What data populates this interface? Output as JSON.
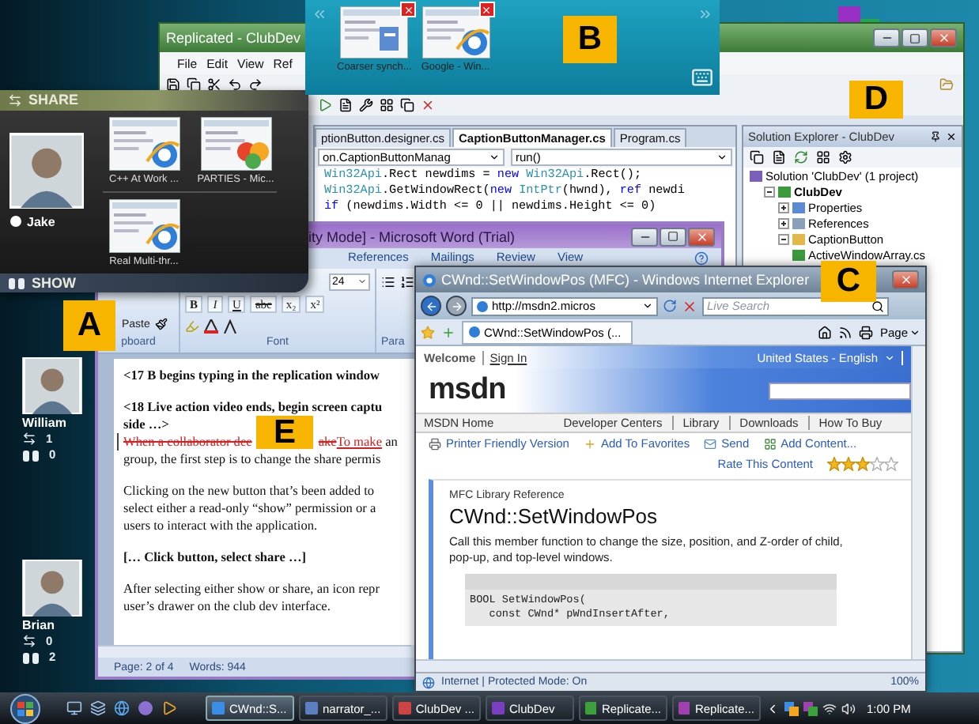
{
  "share_panel": {
    "header": "SHARE",
    "user": "Jake",
    "footer": "SHOW",
    "thumbnails": [
      {
        "caption": "C++ At Work ...",
        "kind": "browser"
      },
      {
        "caption": "PARTIES - Mic...",
        "kind": "messenger"
      },
      {
        "caption": "Real Multi-thr...",
        "kind": "browser"
      }
    ]
  },
  "switcher": {
    "thumbnails": [
      {
        "caption": "Coarser synch...",
        "kind": "document"
      },
      {
        "caption": "Google - Win...",
        "kind": "browser"
      }
    ]
  },
  "people": [
    {
      "name": "William",
      "share_count": "1",
      "show_count": "0"
    },
    {
      "name": "Brian",
      "share_count": "0",
      "show_count": "2"
    }
  ],
  "callouts": [
    "A",
    "B",
    "C",
    "D",
    "E"
  ],
  "visual_studio": {
    "title": "Replicated - ClubDev",
    "menu": [
      "File",
      "Edit",
      "View",
      "Ref"
    ],
    "tabs": [
      {
        "label": "ptionButton.designer.cs",
        "selected": false
      },
      {
        "label": "CaptionButtonManager.cs",
        "selected": true
      },
      {
        "label": "Program.cs",
        "selected": false
      }
    ],
    "type_combo": "on.CaptionButtonManag",
    "member_combo": "run()",
    "code_lines": [
      [
        {
          "kind": "type",
          "text": "Win32Api"
        },
        {
          "kind": "plain",
          "text": ".Rect newdims = "
        },
        {
          "kind": "keyword",
          "text": "new "
        },
        {
          "kind": "type",
          "text": "Win32Api"
        },
        {
          "kind": "plain",
          "text": ".Rect();"
        }
      ],
      [
        {
          "kind": "type",
          "text": "Win32Api"
        },
        {
          "kind": "plain",
          "text": ".GetWindowRect("
        },
        {
          "kind": "keyword",
          "text": "new "
        },
        {
          "kind": "type",
          "text": "IntPtr"
        },
        {
          "kind": "plain",
          "text": "(hwnd), "
        },
        {
          "kind": "keyword",
          "text": "ref"
        },
        {
          "kind": "plain",
          "text": " newdi"
        }
      ],
      [
        {
          "kind": "keyword",
          "text": "if"
        },
        {
          "kind": "plain",
          "text": " (newdims.Width <= 0 || newdims.Height <= 0)"
        }
      ]
    ],
    "solution_explorer": {
      "title": "Solution Explorer - ClubDev",
      "tree": [
        {
          "label": "Solution 'ClubDev' (1 project)",
          "kind": "solution",
          "children": [
            {
              "label": "ClubDev",
              "kind": "project",
              "expanded": true,
              "children": [
                {
                  "label": "Properties",
                  "kind": "properties",
                  "expanded": false
                },
                {
                  "label": "References",
                  "kind": "references",
                  "expanded": false
                },
                {
                  "label": "CaptionButton",
                  "kind": "folder",
                  "expanded": true,
                  "children": [
                    {
                      "label": "ActiveWindowArray.cs",
                      "kind": "file"
                    }
                  ]
                }
              ]
            }
          ]
        }
      ]
    }
  },
  "word": {
    "title": "ity Mode] - Microsoft Word (Trial)",
    "ribbon_tabs": [
      {
        "label": "References",
        "selected": false
      },
      {
        "label": "Mailings",
        "selected": false
      },
      {
        "label": "Review",
        "selected": false
      },
      {
        "label": "View",
        "selected": false
      }
    ],
    "paste": "Paste",
    "font_size": "24",
    "format_buttons": [
      "B",
      "I",
      "U",
      "abc",
      "x₂",
      "x²"
    ],
    "groups": [
      "pboard",
      "Font",
      "Para"
    ],
    "document": [
      [
        {
          "kind": "text",
          "bold": true,
          "text": "<17 B begins typing in the replication window"
        }
      ],
      [
        {
          "kind": "text",
          "bold": true,
          "text": "<18 Live action video ends, begin screen captu"
        },
        {
          "kind": "text",
          "bold": true,
          "text": "side …>"
        },
        {
          "kind": "revision",
          "segments": [
            {
              "kind": "deleted",
              "text": "When a collaborator dee"
            },
            {
              "kind": "deleted",
              "text": "ake",
              "after_gap": true
            },
            {
              "kind": "inserted",
              "text": "To make"
            },
            {
              "kind": "plain",
              "text": " an"
            }
          ]
        },
        {
          "kind": "text",
          "bold": false,
          "text": "group, the first step is to change the share permis"
        }
      ],
      [
        {
          "kind": "text",
          "bold": false,
          "text": "Clicking on the new button that’s been added to"
        },
        {
          "kind": "text",
          "bold": false,
          "text": "select either a read-only “show” permission  or a"
        },
        {
          "kind": "text",
          "bold": false,
          "text": "users to interact with the application."
        }
      ],
      [
        {
          "kind": "text",
          "bold": true,
          "text": "[… Click button, select share …]"
        }
      ],
      [
        {
          "kind": "text",
          "bold": false,
          "text": "After selecting either show or share, an icon repr"
        },
        {
          "kind": "text",
          "bold": false,
          "text": "user’s drawer on the club dev interface."
        }
      ]
    ],
    "status": [
      "Page: 2 of 4",
      "Words: 944"
    ]
  },
  "internet_explorer": {
    "title": "CWnd::SetWindowPos (MFC) - Windows Internet Explorer",
    "address": "http://msdn2.micros",
    "search_placeholder": "Live Search",
    "tab": "CWnd::SetWindowPos (...",
    "page_menu": "Page",
    "welcome": "Welcome",
    "sign_in": "Sign In",
    "locale": "United States - English",
    "logo": "msdn",
    "nav": [
      "MSDN Home",
      "Developer Centers",
      "Library",
      "Downloads",
      "How To Buy"
    ],
    "actions": [
      {
        "label": "Printer Friendly Version",
        "kind": "print"
      },
      {
        "label": "Add To Favorites",
        "kind": "favorite"
      },
      {
        "label": "Send",
        "kind": "send"
      },
      {
        "label": "Add Content...",
        "kind": "content"
      }
    ],
    "rate_label": "Rate This Content",
    "stars": 3,
    "breadcrumb": "MFC Library Reference",
    "heading": "CWnd::SetWindowPos",
    "description": "Call this member function to change the size, position, and Z-order of child, pop-up, and top-level windows.",
    "code": [
      "BOOL SetWindowPos(",
      "   const CWnd* pWndInsertAfter,"
    ],
    "status": "Internet | Protected Mode: On",
    "zoom": "100%"
  },
  "taskbar": {
    "tasks": [
      {
        "label": "CWnd::S...",
        "kind": "browser",
        "selected": true
      },
      {
        "label": "narrator_...",
        "kind": "document",
        "selected": false
      },
      {
        "label": "ClubDev ...",
        "kind": "studio",
        "selected": false
      },
      {
        "label": "ClubDev",
        "kind": "app",
        "selected": false
      },
      {
        "label": "Replicate...",
        "kind": "replicate",
        "selected": false
      },
      {
        "label": "Replicate...",
        "kind": "share",
        "selected": false
      }
    ],
    "clock": "1:00 PM"
  }
}
